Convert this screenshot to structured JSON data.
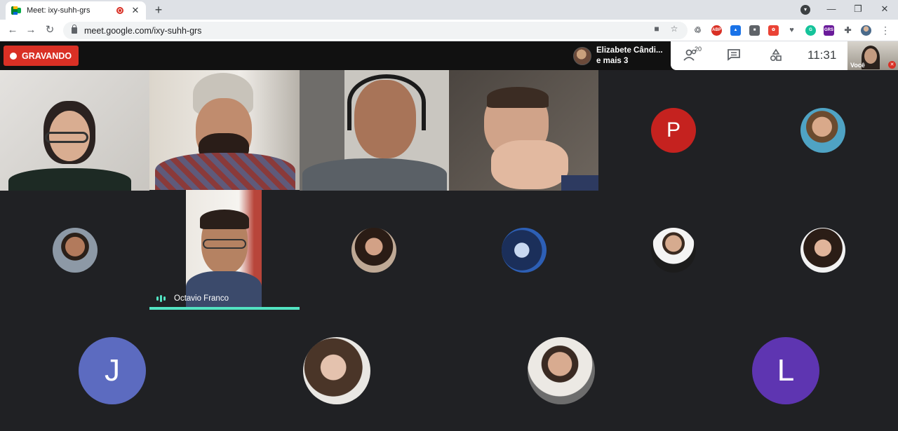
{
  "browser": {
    "tab_title": "Meet: ixy-suhh-grs",
    "new_tab_symbol": "+",
    "url": "meet.google.com/ixy-suhh-grs",
    "window_controls": [
      "minimize",
      "restore",
      "close"
    ]
  },
  "meet": {
    "recording_label": "GRAVANDO",
    "presenter": {
      "line1": "Elizabete Cândi...",
      "line2": "e mais 3"
    },
    "participants_count": "20",
    "time": "11:31",
    "self_label": "Você",
    "active_speaker": "Octavio Franco",
    "letter_avatars": {
      "p": "P",
      "j": "J",
      "l": "L"
    },
    "colors": {
      "recording": "#d93025",
      "speaking": "#52e3c2",
      "avatar_p": "#c5221f",
      "avatar_j": "#5c6bc0",
      "avatar_l": "#5e35b1",
      "background": "#202124"
    }
  }
}
